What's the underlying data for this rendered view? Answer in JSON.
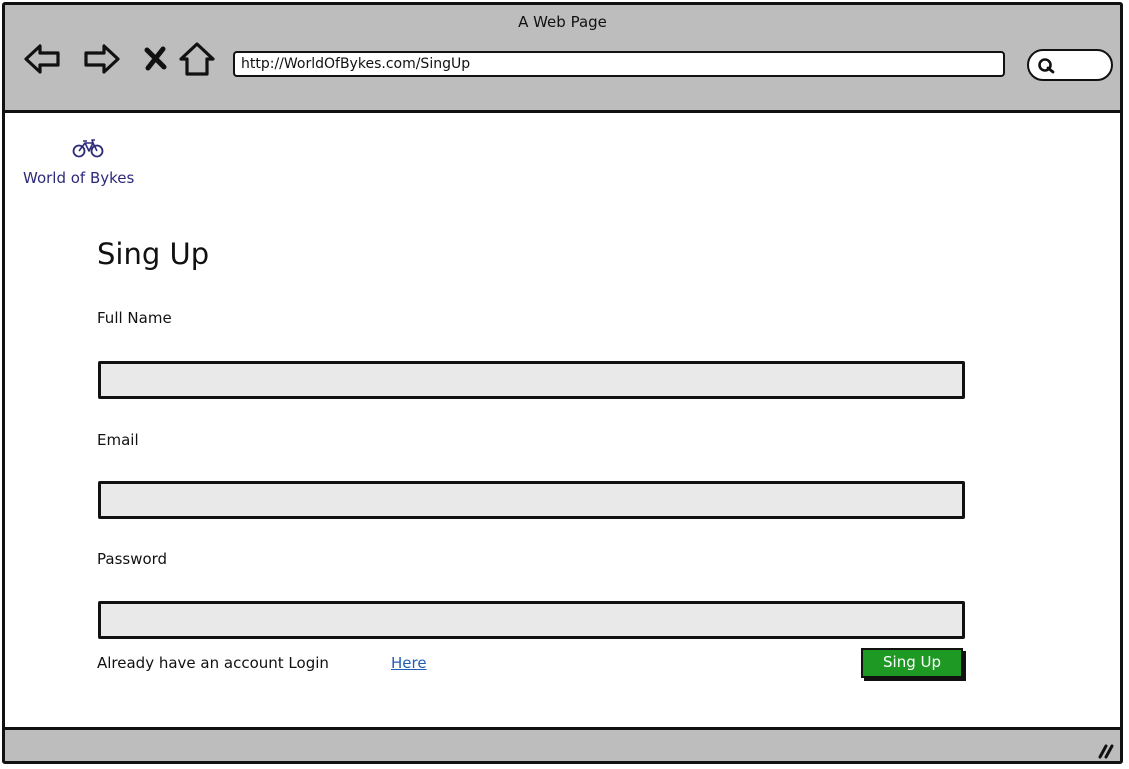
{
  "window": {
    "title": "A Web Page"
  },
  "toolbar": {
    "back_icon": "back-arrow-icon",
    "forward_icon": "forward-arrow-icon",
    "stop_icon": "close-icon",
    "home_icon": "home-icon",
    "url": "http://WorldOfBykes.com/SingUp",
    "search_icon": "search-icon"
  },
  "brand": {
    "icon": "bicycle-icon",
    "name": "World of Bykes",
    "color": "#2e2a7a"
  },
  "form": {
    "title": "Sing Up",
    "fields": [
      {
        "label": "Full Name",
        "value": ""
      },
      {
        "label": "Email",
        "value": ""
      },
      {
        "label": "Password",
        "value": ""
      }
    ],
    "login_prompt": "Already have an account Login",
    "login_link": "Here",
    "submit_label": "Sing Up",
    "submit_color": "#1e9a24",
    "link_color": "#1f5fb3"
  },
  "statusbar": {
    "resize_icon": "resize-grip-icon"
  }
}
